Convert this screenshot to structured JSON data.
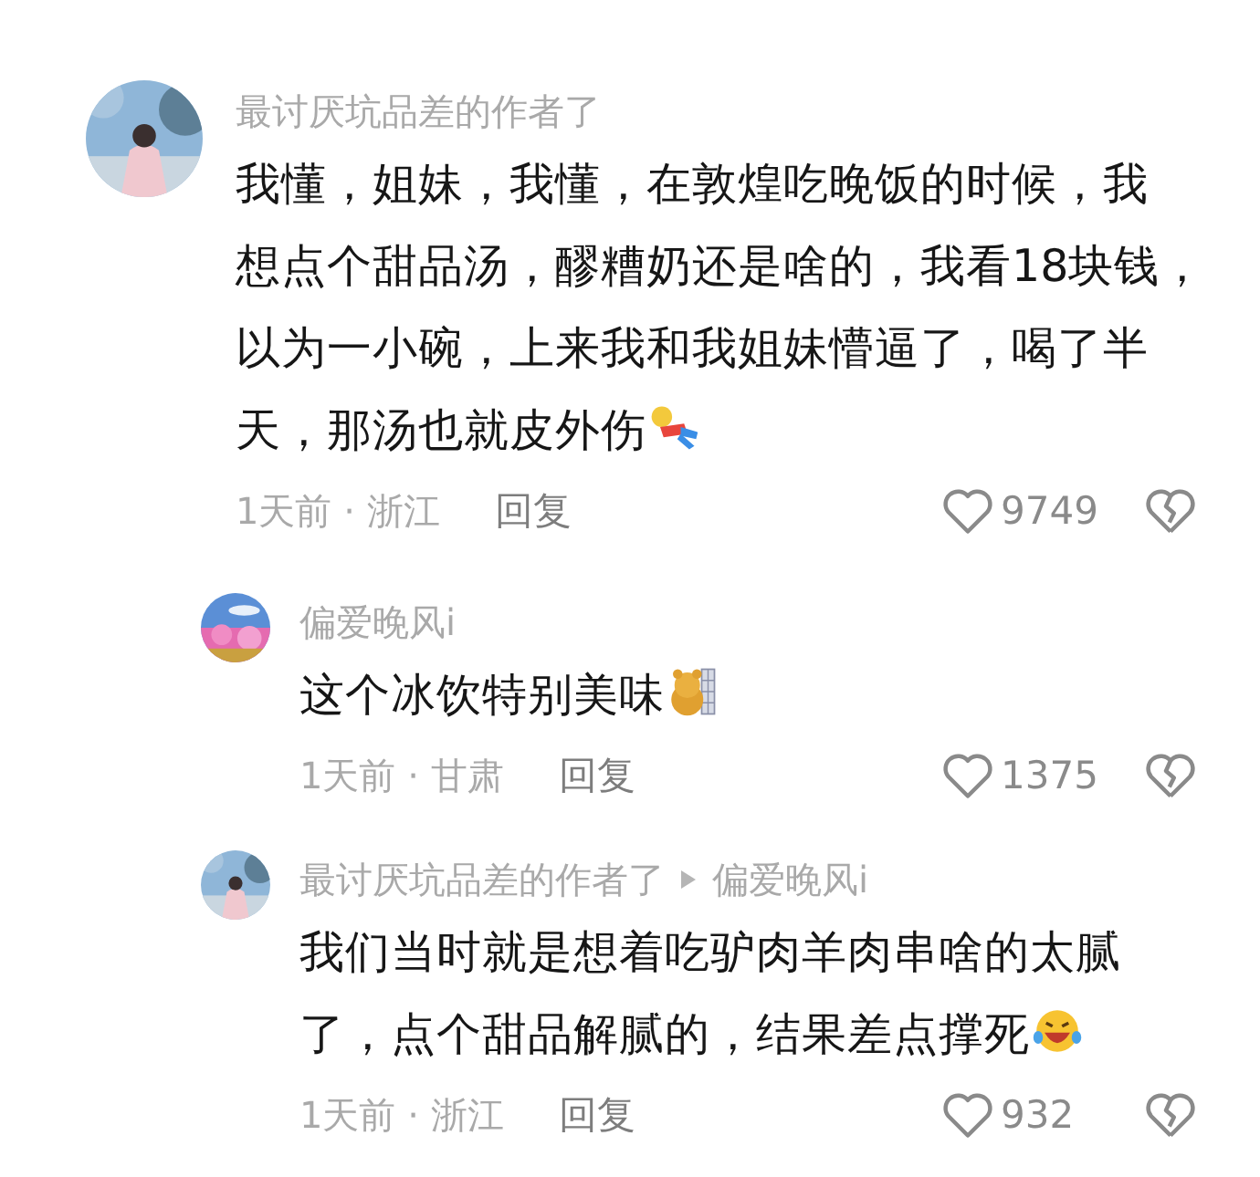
{
  "comments": [
    {
      "kind": "main",
      "author": "最讨厌坑品差的作者了",
      "text_lines": [
        "我懂，姐妹，我懂，在敦煌吃晚饭的时候，我",
        "想点个甜品汤，醪糟奶还是啥的，我看18块钱，",
        "以为一小碗，上来我和我姐妹懵逼了，喝了半",
        "天，那汤也就皮外伤"
      ],
      "emoji": {
        "kind": "figure"
      },
      "meta": "1天前 · 浙江",
      "reply_label": "回复",
      "likes": "9749"
    },
    {
      "kind": "reply",
      "author": "偏爱晚风i",
      "text_lines": [
        "这个冰饮特别美味"
      ],
      "emoji": {
        "kind": "bear"
      },
      "meta": "1天前 · 甘肃",
      "reply_label": "回复",
      "likes": "1375"
    },
    {
      "kind": "reply",
      "author": "最讨厌坑品差的作者了",
      "reply_to": "偏爱晚风i",
      "text_lines": [
        "我们当时就是想着吃驴肉羊肉串啥的太腻",
        "了，点个甜品解腻的，结果差点撑死"
      ],
      "emoji": {
        "kind": "laughing"
      },
      "meta": "1天前 · 浙江",
      "reply_label": "回复",
      "likes": "932"
    }
  ]
}
